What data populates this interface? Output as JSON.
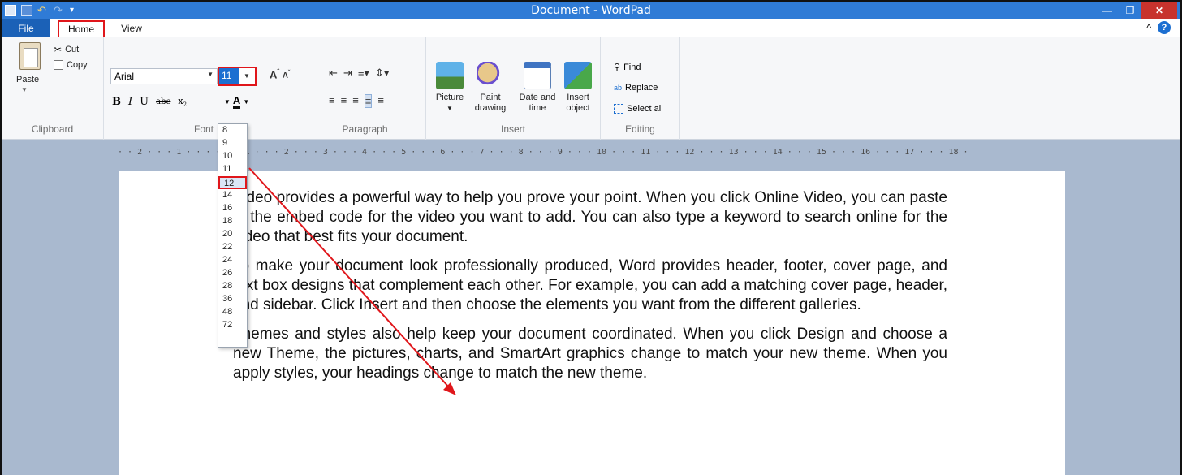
{
  "window": {
    "title": "Document - WordPad"
  },
  "tabs": {
    "file": "File",
    "home": "Home",
    "view": "View"
  },
  "ribbon": {
    "clipboard": {
      "label": "Clipboard",
      "paste": "Paste",
      "cut": "Cut",
      "copy": "Copy"
    },
    "font": {
      "label": "Font",
      "family": "Arial",
      "size": "11"
    },
    "paragraph": {
      "label": "Paragraph"
    },
    "insert": {
      "label": "Insert",
      "picture": "Picture",
      "paint_1": "Paint",
      "paint_2": "drawing",
      "date_1": "Date and",
      "date_2": "time",
      "object_1": "Insert",
      "object_2": "object"
    },
    "editing": {
      "label": "Editing",
      "find": "Find",
      "replace": "Replace",
      "select_all": "Select all"
    }
  },
  "ruler": "· · 2 · · · 1 · · ·                 · · · 1 · · · 2 · · · 3 · · · 4 · · · 5 · · · 6 · · · 7 · · · 8 · · · 9 · · · 10 · · · 11 · · · 12 · · · 13 · · · 14 · · · 15 · · · 16 · · · 17 · · · 18 ·",
  "font_sizes": [
    "8",
    "9",
    "10",
    "11",
    "12",
    "14",
    "16",
    "18",
    "20",
    "22",
    "24",
    "26",
    "28",
    "36",
    "48",
    "72"
  ],
  "selected_size": "12",
  "document": {
    "p1": "Video provides a powerful way to help you prove your point. When you click Online Video, you can paste in the embed code for the video you want to add. You can also type a keyword to search online for the video that best fits your document.",
    "p2": "To make your document look professionally produced, Word provides header, footer, cover page, and text box designs that complement each other. For example, you can add a matching cover page, header, and sidebar. Click Insert and then choose the elements you want from the different galleries.",
    "p3": "Themes and styles also help keep your document coordinated. When you click Design and choose a new Theme, the pictures, charts, and SmartArt graphics change to match your new theme. When you apply styles, your headings change to match the new theme."
  },
  "colors": {
    "titlebar": "#2f7bd6",
    "file_tab": "#1b61b7",
    "highlight": "#e0161b",
    "close": "#c7332d"
  }
}
